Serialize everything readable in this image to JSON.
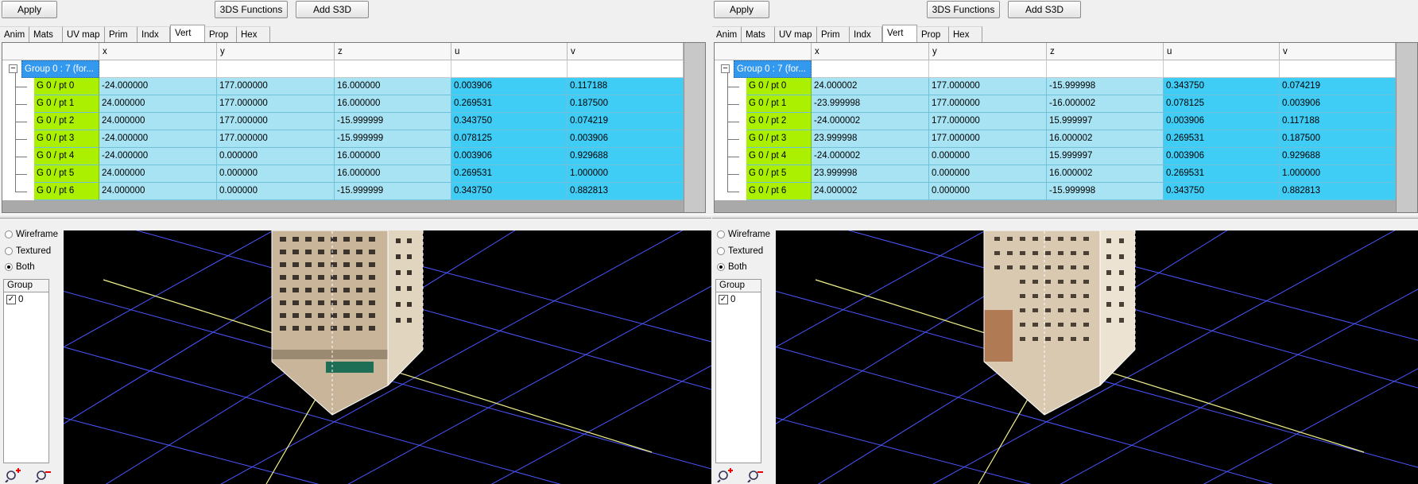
{
  "toolbar": {
    "apply_label": "Apply",
    "functions_label": "3DS Functions",
    "add_label": "Add S3D"
  },
  "tabs": [
    "Anim",
    "Mats",
    "UV map",
    "Prim",
    "Indx",
    "Vert",
    "Prop",
    "Hex"
  ],
  "active_tab": "Vert",
  "columns": [
    "x",
    "y",
    "z",
    "u",
    "v"
  ],
  "group_label": "Group 0 : 7 (for...",
  "render_modes": [
    "Wireframe",
    "Textured",
    "Both"
  ],
  "selected_render_mode": "Both",
  "group_list": {
    "header": "Group",
    "items": [
      {
        "label": "0",
        "checked": true
      }
    ]
  },
  "colors": {
    "name_cell": "#aaf000",
    "xyz_cell": "#a8e3f4",
    "uv_cell": "#3fcdf5",
    "group_highlight": "#3399ee",
    "grid_line": "#4a55ff",
    "axis_line": "#f2f28a"
  },
  "panels": [
    {
      "rows": [
        {
          "name": "G 0 / pt 0",
          "x": "-24.000000",
          "y": "177.000000",
          "z": "16.000000",
          "u": "0.003906",
          "v": "0.117188"
        },
        {
          "name": "G 0 / pt 1",
          "x": "24.000000",
          "y": "177.000000",
          "z": "16.000000",
          "u": "0.269531",
          "v": "0.187500"
        },
        {
          "name": "G 0 / pt 2",
          "x": "24.000000",
          "y": "177.000000",
          "z": "-15.999999",
          "u": "0.343750",
          "v": "0.074219"
        },
        {
          "name": "G 0 / pt 3",
          "x": "-24.000000",
          "y": "177.000000",
          "z": "-15.999999",
          "u": "0.078125",
          "v": "0.003906"
        },
        {
          "name": "G 0 / pt 4",
          "x": "-24.000000",
          "y": "0.000000",
          "z": "16.000000",
          "u": "0.003906",
          "v": "0.929688"
        },
        {
          "name": "G 0 / pt 5",
          "x": "24.000000",
          "y": "0.000000",
          "z": "16.000000",
          "u": "0.269531",
          "v": "1.000000"
        },
        {
          "name": "G 0 / pt 6",
          "x": "24.000000",
          "y": "0.000000",
          "z": "-15.999999",
          "u": "0.343750",
          "v": "0.882813"
        }
      ]
    },
    {
      "rows": [
        {
          "name": "G 0 / pt 0",
          "x": "24.000002",
          "y": "177.000000",
          "z": "-15.999998",
          "u": "0.343750",
          "v": "0.074219"
        },
        {
          "name": "G 0 / pt 1",
          "x": "-23.999998",
          "y": "177.000000",
          "z": "-16.000002",
          "u": "0.078125",
          "v": "0.003906"
        },
        {
          "name": "G 0 / pt 2",
          "x": "-24.000002",
          "y": "177.000000",
          "z": "15.999997",
          "u": "0.003906",
          "v": "0.117188"
        },
        {
          "name": "G 0 / pt 3",
          "x": "23.999998",
          "y": "177.000000",
          "z": "16.000002",
          "u": "0.269531",
          "v": "0.187500"
        },
        {
          "name": "G 0 / pt 4",
          "x": "-24.000002",
          "y": "0.000000",
          "z": "15.999997",
          "u": "0.003906",
          "v": "0.929688"
        },
        {
          "name": "G 0 / pt 5",
          "x": "23.999998",
          "y": "0.000000",
          "z": "16.000002",
          "u": "0.269531",
          "v": "1.000000"
        },
        {
          "name": "G 0 / pt 6",
          "x": "24.000002",
          "y": "0.000000",
          "z": "-15.999998",
          "u": "0.343750",
          "v": "0.882813"
        }
      ]
    }
  ]
}
